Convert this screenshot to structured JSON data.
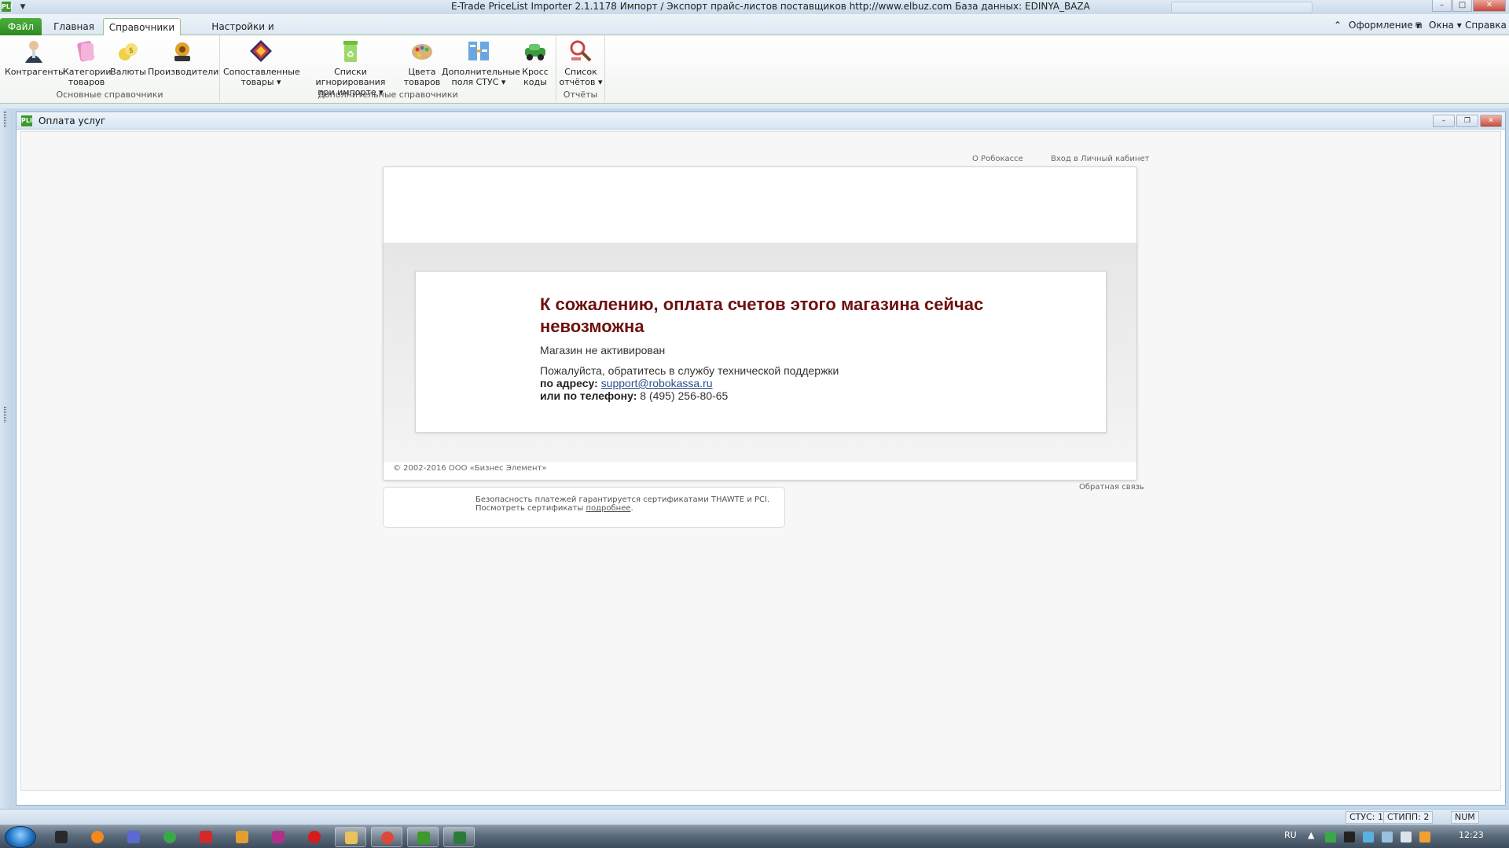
{
  "window": {
    "app_icon_text": "PLI",
    "title": "E-Trade PriceList Importer 2.1.1178     Импорт / Экспорт прайс-листов поставщиков      http://www.elbuz.com      База данных: EDINYA_BAZA"
  },
  "ribbon": {
    "file_tab": "Файл",
    "tabs": [
      "Главная",
      "Справочники",
      "Настройки и операции"
    ],
    "active_tab": "Справочники",
    "right_menu": [
      "Оформление",
      "Окна",
      "Справка"
    ],
    "groups": [
      {
        "label": "Основные справочники",
        "buttons": [
          {
            "line1": "Контрагенты",
            "line2": "",
            "icon": "contractor-icon"
          },
          {
            "line1": "Категории",
            "line2": "товаров",
            "icon": "category-icon"
          },
          {
            "line1": "Валюты",
            "line2": "",
            "icon": "currency-icon"
          },
          {
            "line1": "Производители",
            "line2": "",
            "icon": "manufacturer-icon"
          }
        ]
      },
      {
        "label": "Дополнительные справочники",
        "buttons": [
          {
            "line1": "Сопоставленные",
            "line2": "товары",
            "icon": "matched-goods-icon",
            "dropdown": true
          },
          {
            "line1": "Списки игнорирования",
            "line2": "при импорте",
            "icon": "ignore-list-icon",
            "dropdown": true
          },
          {
            "line1": "Цвета",
            "line2": "товаров",
            "icon": "palette-icon"
          },
          {
            "line1": "Дополнительные",
            "line2": "поля СТУС",
            "icon": "extra-fields-icon",
            "dropdown": true
          },
          {
            "line1": "Кросс",
            "line2": "коды",
            "icon": "cross-codes-icon"
          }
        ]
      },
      {
        "label": "Отчёты",
        "buttons": [
          {
            "line1": "Список",
            "line2": "отчётов",
            "icon": "reports-icon",
            "dropdown": true
          }
        ]
      }
    ]
  },
  "child_window": {
    "icon_text": "PLI",
    "title": "Оплата услуг"
  },
  "page": {
    "top_links": [
      "О Робокассе",
      "Вход в Личный кабинет"
    ],
    "heading": "К сожалению, оплата счетов этого магазина сейчас невозможна",
    "subheading": "Магазин не активирован",
    "help_line": "Пожалуйста, обратитесь в службу технической поддержки",
    "address_label": "по адресу:",
    "email": "support@robokassa.ru",
    "phone_label": "или по телефону:",
    "phone": "8 (495) 256-80-65",
    "copyright": "© 2002-2016 ООО «Бизнес Элемент»",
    "feedback": "Обратная связь",
    "security_line1": "Безопасность платежей гарантируется сертификатами THAWTE и PCI.",
    "security_line2_prefix": "Посмотреть сертификаты",
    "security_link": "подробнее",
    "security_line2_suffix": "."
  },
  "statusbar": {
    "stus": "СТУС: 1",
    "stipp": "СТИПП: 2",
    "num": "NUM"
  },
  "taskbar": {
    "lang": "RU",
    "time": "12:23"
  },
  "colors": {
    "heading": "#6e1010",
    "link": "#2a4f8c",
    "file_tab": "#2d8a21"
  }
}
